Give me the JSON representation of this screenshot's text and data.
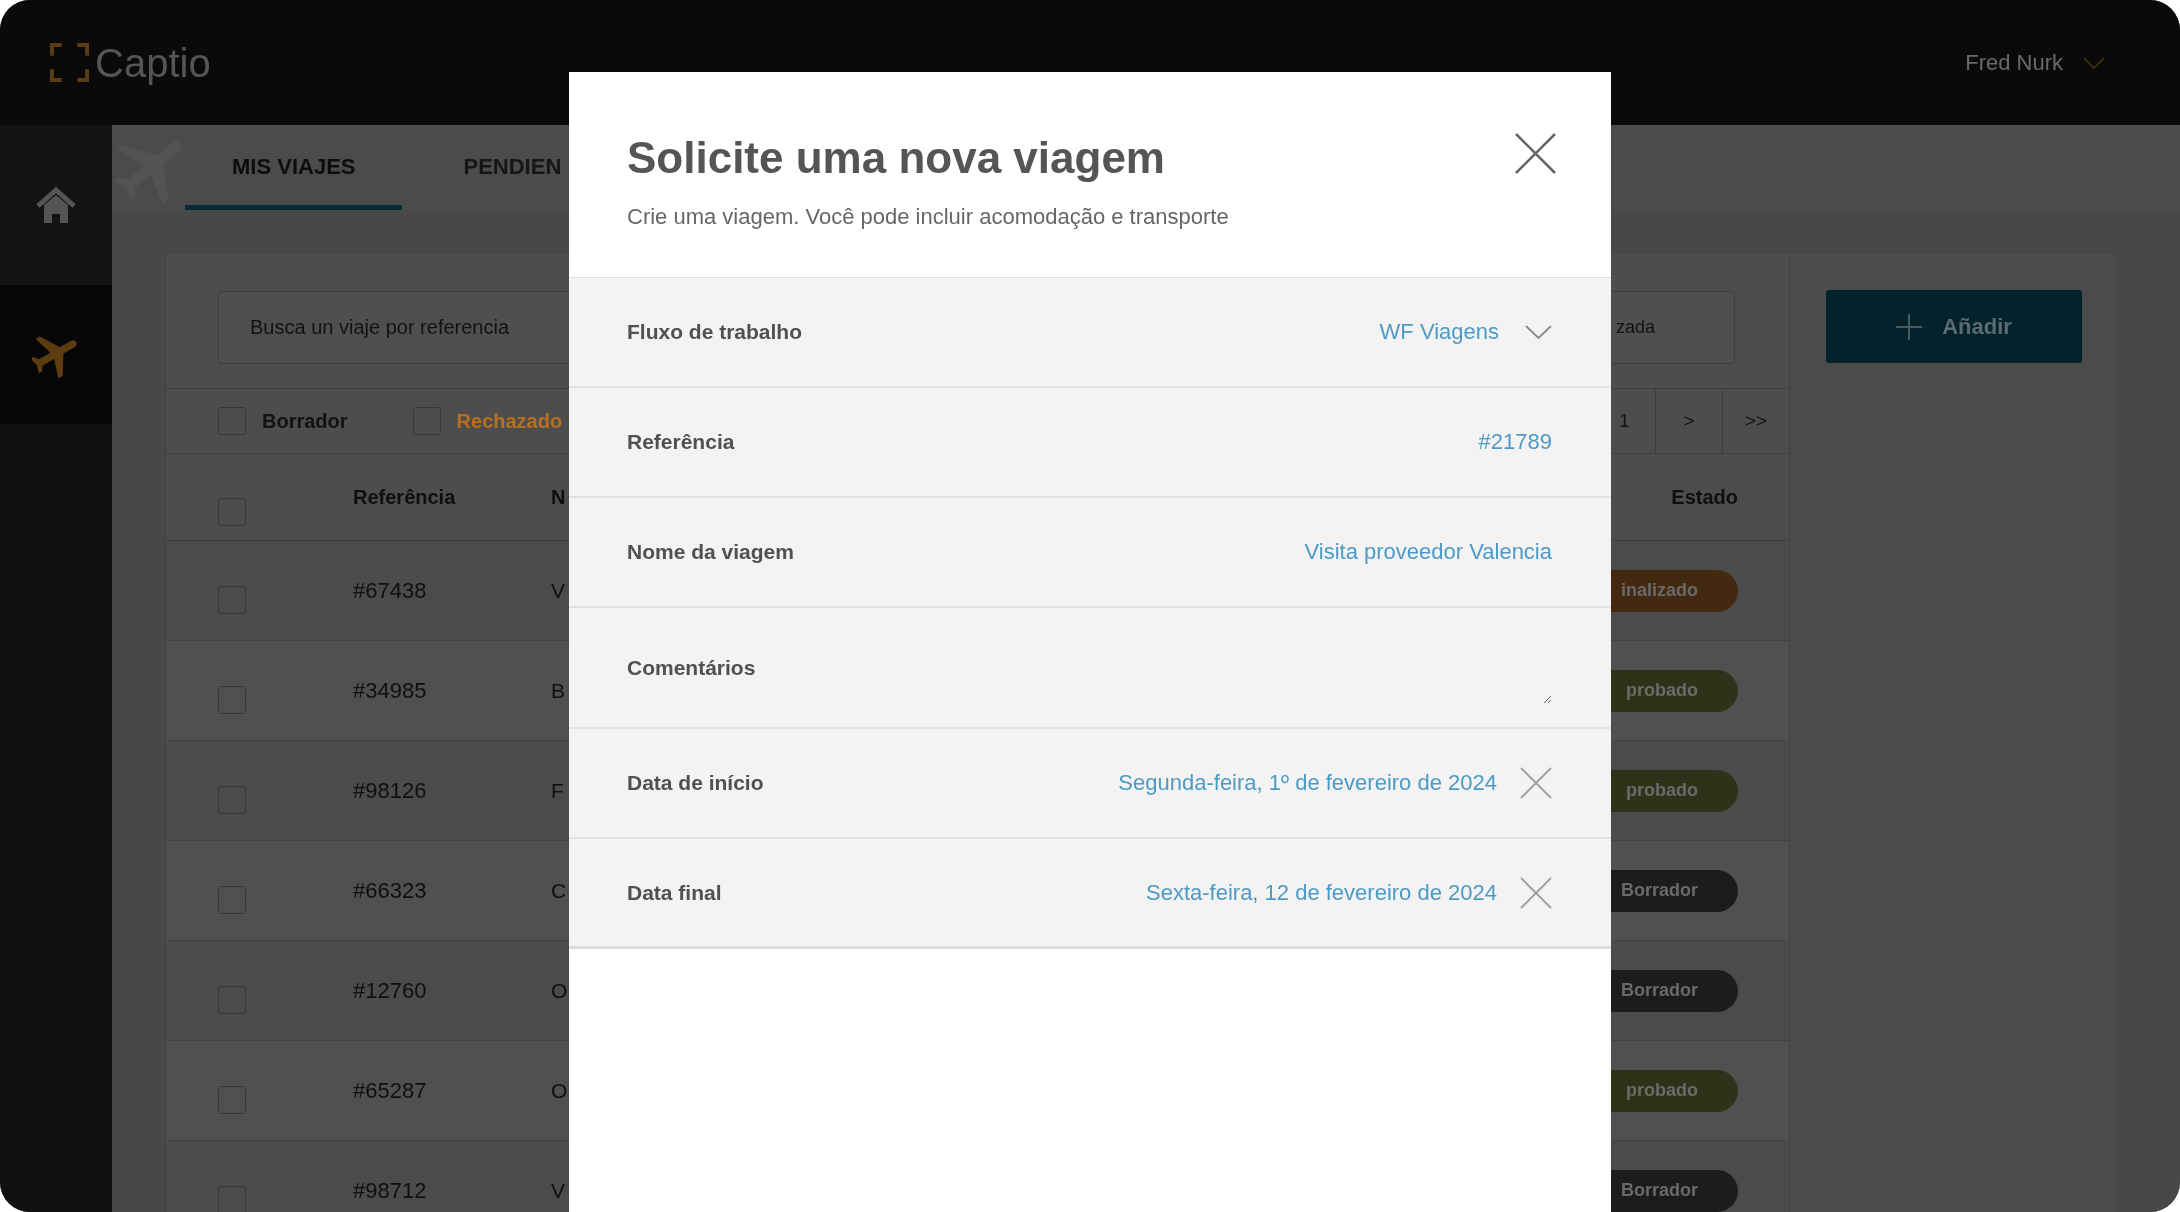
{
  "top_bar": {
    "logo": "Captio",
    "user_name": "Fred Nurk"
  },
  "sidebar": {
    "items": [
      {
        "kind": "home",
        "selected": false
      },
      {
        "kind": "trips",
        "selected": true
      }
    ]
  },
  "tabs": [
    {
      "label": "MIS VIAJES",
      "selected": true
    },
    {
      "label": "PENDIEN",
      "selected": false
    }
  ],
  "search": {
    "placeholder": "Busca un viaje por referencia",
    "right_text": "zada"
  },
  "filters": [
    {
      "label": "Borrador",
      "checked": false,
      "color": "#121212"
    },
    {
      "label": "Rechazado",
      "checked": false,
      "color": "#b8701f"
    }
  ],
  "pagination": [
    {
      "label": "1"
    },
    {
      "label": ">"
    },
    {
      "label": ">>"
    }
  ],
  "add_button": {
    "label": "Añadir"
  },
  "table": {
    "checked": false,
    "columns": [
      "Referência",
      "N",
      "Estado"
    ],
    "rows": [
      {
        "checked": false,
        "reference": "#67438",
        "column_3": "V",
        "status": {
          "label": "inalizado",
          "color": "#43290f"
        }
      },
      {
        "checked": false,
        "reference": "#34985",
        "column_3": "B",
        "status": {
          "label": "probado",
          "color": "#2d3318"
        }
      },
      {
        "checked": false,
        "reference": "#98126",
        "column_3": "F",
        "status": {
          "label": "probado",
          "color": "#2d3318"
        }
      },
      {
        "checked": false,
        "reference": "#66323",
        "column_3": "C",
        "status": {
          "label": "Borrador",
          "color": "#1c1c1c"
        }
      },
      {
        "checked": false,
        "reference": "#12760",
        "column_3": "O",
        "status": {
          "label": "Borrador",
          "color": "#1c1c1c"
        }
      },
      {
        "checked": false,
        "reference": "#65287",
        "column_3": "O",
        "status": {
          "label": "probado",
          "color": "#2d3318"
        }
      },
      {
        "checked": false,
        "reference": "#98712",
        "column_3": "V",
        "status": {
          "label": "Borrador",
          "color": "#1c1c1c"
        }
      }
    ]
  },
  "modal": {
    "title": "Solicite uma nova viagem",
    "subtitle": "Crie uma viagem. Você pode incluir acomodação e transporte",
    "fields": [
      {
        "kind": "select",
        "label": "Fluxo de trabalho",
        "value": "WF Viagens"
      },
      {
        "kind": "readonly",
        "label": "Referência",
        "value": "#21789"
      },
      {
        "kind": "input",
        "label": "Nome da viagem",
        "value": "Visita proveedor Valencia"
      },
      {
        "kind": "textarea",
        "label": "Comentários"
      },
      {
        "kind": "date",
        "label": "Data de início",
        "value": "Segunda-feira, 1º de fevereiro de 2024"
      },
      {
        "kind": "date",
        "label": "Data final",
        "value": "Sexta-feira, 12 de fevereiro de 2024"
      }
    ]
  }
}
